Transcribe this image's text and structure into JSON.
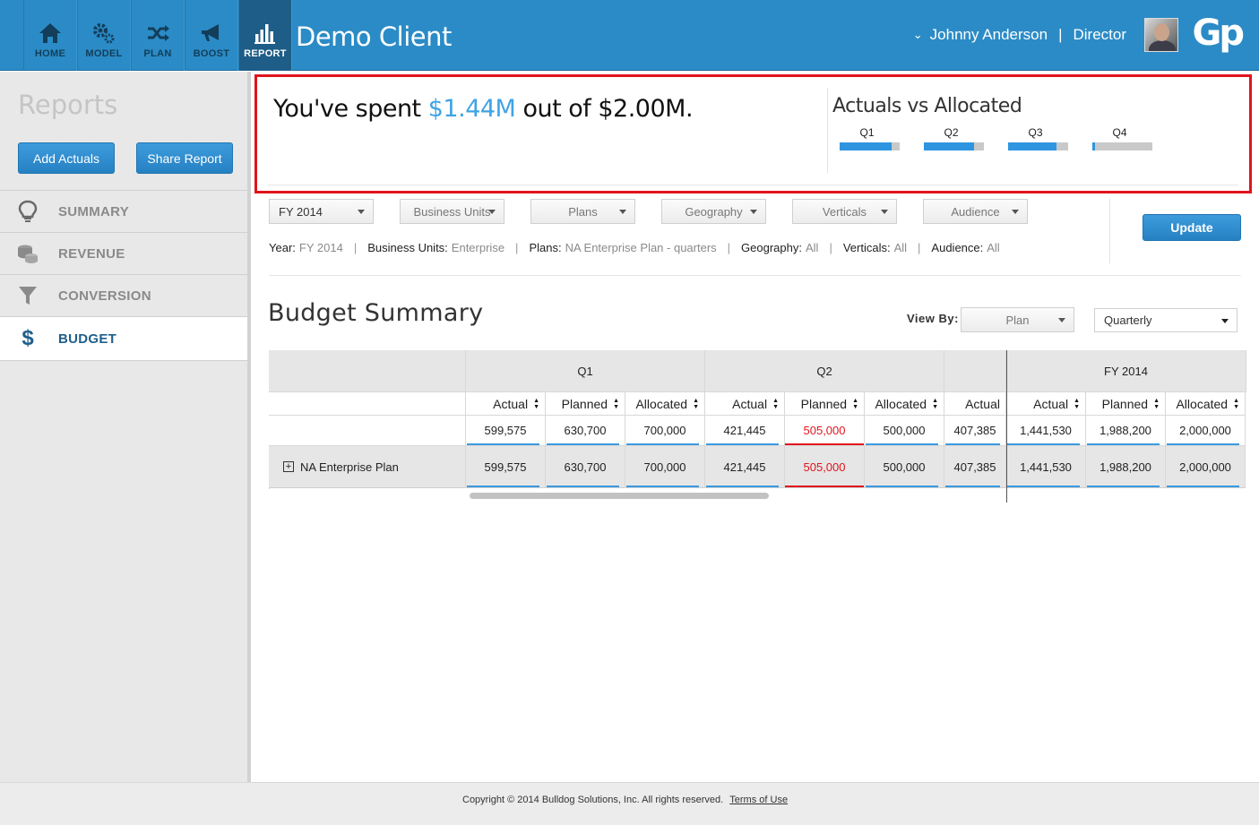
{
  "nav": {
    "items": [
      {
        "label": "HOME"
      },
      {
        "label": "MODEL"
      },
      {
        "label": "PLAN"
      },
      {
        "label": "BOOST"
      },
      {
        "label": "REPORT"
      }
    ],
    "app_title": "Demo Client"
  },
  "user": {
    "name": "Johnny Anderson",
    "separator": "|",
    "role": "Director"
  },
  "brand": {
    "logo": "Gp",
    "primary_color": "#2b8bc6",
    "accent_color": "#3ea3e6",
    "alert_color": "#e0141c"
  },
  "sidebar": {
    "title": "Reports",
    "add_actuals": "Add Actuals",
    "share_report": "Share Report",
    "items": [
      {
        "label": "SUMMARY",
        "icon": "lightbulb-icon"
      },
      {
        "label": "REVENUE",
        "icon": "coins-icon"
      },
      {
        "label": "CONVERSION",
        "icon": "funnel-icon"
      },
      {
        "label": "BUDGET",
        "icon": "dollar-icon"
      }
    ]
  },
  "spend": {
    "prefix": "You've spent",
    "spent": "$1.44M",
    "middle": "out of",
    "total": "$2.00M."
  },
  "actuals_vs_allocated": {
    "title": "Actuals vs Allocated",
    "quarters": [
      {
        "label": "Q1",
        "fraction": 0.86
      },
      {
        "label": "Q2",
        "fraction": 0.84
      },
      {
        "label": "Q3",
        "fraction": 0.81
      },
      {
        "label": "Q4",
        "fraction": 0.04
      }
    ]
  },
  "filters": {
    "dropdowns": [
      {
        "label": "FY 2014"
      },
      {
        "label": "Business Units"
      },
      {
        "label": "Plans"
      },
      {
        "label": "Geography"
      },
      {
        "label": "Verticals"
      },
      {
        "label": "Audience"
      }
    ],
    "update": "Update",
    "summary": [
      {
        "key": "Year:",
        "value": "FY 2014"
      },
      {
        "key": "Business Units:",
        "value": "Enterprise"
      },
      {
        "key": "Plans:",
        "value": "NA Enterprise Plan - quarters"
      },
      {
        "key": "Geography:",
        "value": "All"
      },
      {
        "key": "Verticals:",
        "value": "All"
      },
      {
        "key": "Audience:",
        "value": "All"
      }
    ]
  },
  "budget": {
    "title": "Budget Summary",
    "view_by_label": "View By:",
    "view_by_value": "Plan",
    "period_value": "Quarterly",
    "groups": [
      "Q1",
      "Q2",
      "FY 2014"
    ],
    "columns": [
      "Actual",
      "Planned",
      "Allocated",
      "Actual",
      "Planned",
      "Allocated",
      "Actual",
      "Actual",
      "Planned",
      "Allocated"
    ],
    "totals": [
      "599,575",
      "630,700",
      "700,000",
      "421,445",
      "505,000",
      "500,000",
      "407,385",
      "1,441,530",
      "1,988,200",
      "2,000,000"
    ],
    "rows": [
      {
        "name": "NA Enterprise Plan",
        "values": [
          "599,575",
          "630,700",
          "700,000",
          "421,445",
          "505,000",
          "500,000",
          "407,385",
          "1,441,530",
          "1,988,200",
          "2,000,000"
        ]
      }
    ]
  },
  "footer": {
    "copyright": "Copyright © 2014 Bulldog Solutions, Inc. All rights reserved.",
    "terms": "Terms of Use"
  }
}
